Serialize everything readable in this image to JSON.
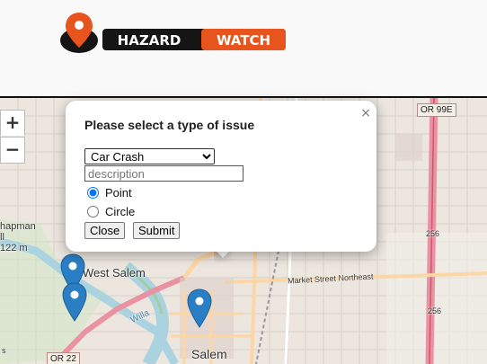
{
  "header": {
    "logo": {
      "brand_left": "HAZARD",
      "brand_right": "WATCH"
    }
  },
  "map": {
    "zoom_in_label": "+",
    "zoom_out_label": "−",
    "labels": {
      "west_salem": "West Salem",
      "salem": "Salem",
      "chapman": "hapman",
      "hill": "ll",
      "elev": "122 m",
      "market_street": "Market Street Northeast",
      "willamette": "Willa",
      "num_256a": "256",
      "num_256b": "256",
      "left_s": "s"
    },
    "shields": {
      "or99e": "OR 99E",
      "or22": "OR 22"
    },
    "colors": {
      "marker": "#2a7fc4",
      "highway": "#e892a2"
    }
  },
  "popup": {
    "close_glyph": "×",
    "title": "Please select a type of issue",
    "issue_type": {
      "selected": "Car Crash"
    },
    "description_placeholder": "description",
    "shape_options": {
      "point": "Point",
      "circle": "Circle"
    },
    "shape_selected": "Point",
    "close_label": "Close",
    "submit_label": "Submit"
  }
}
